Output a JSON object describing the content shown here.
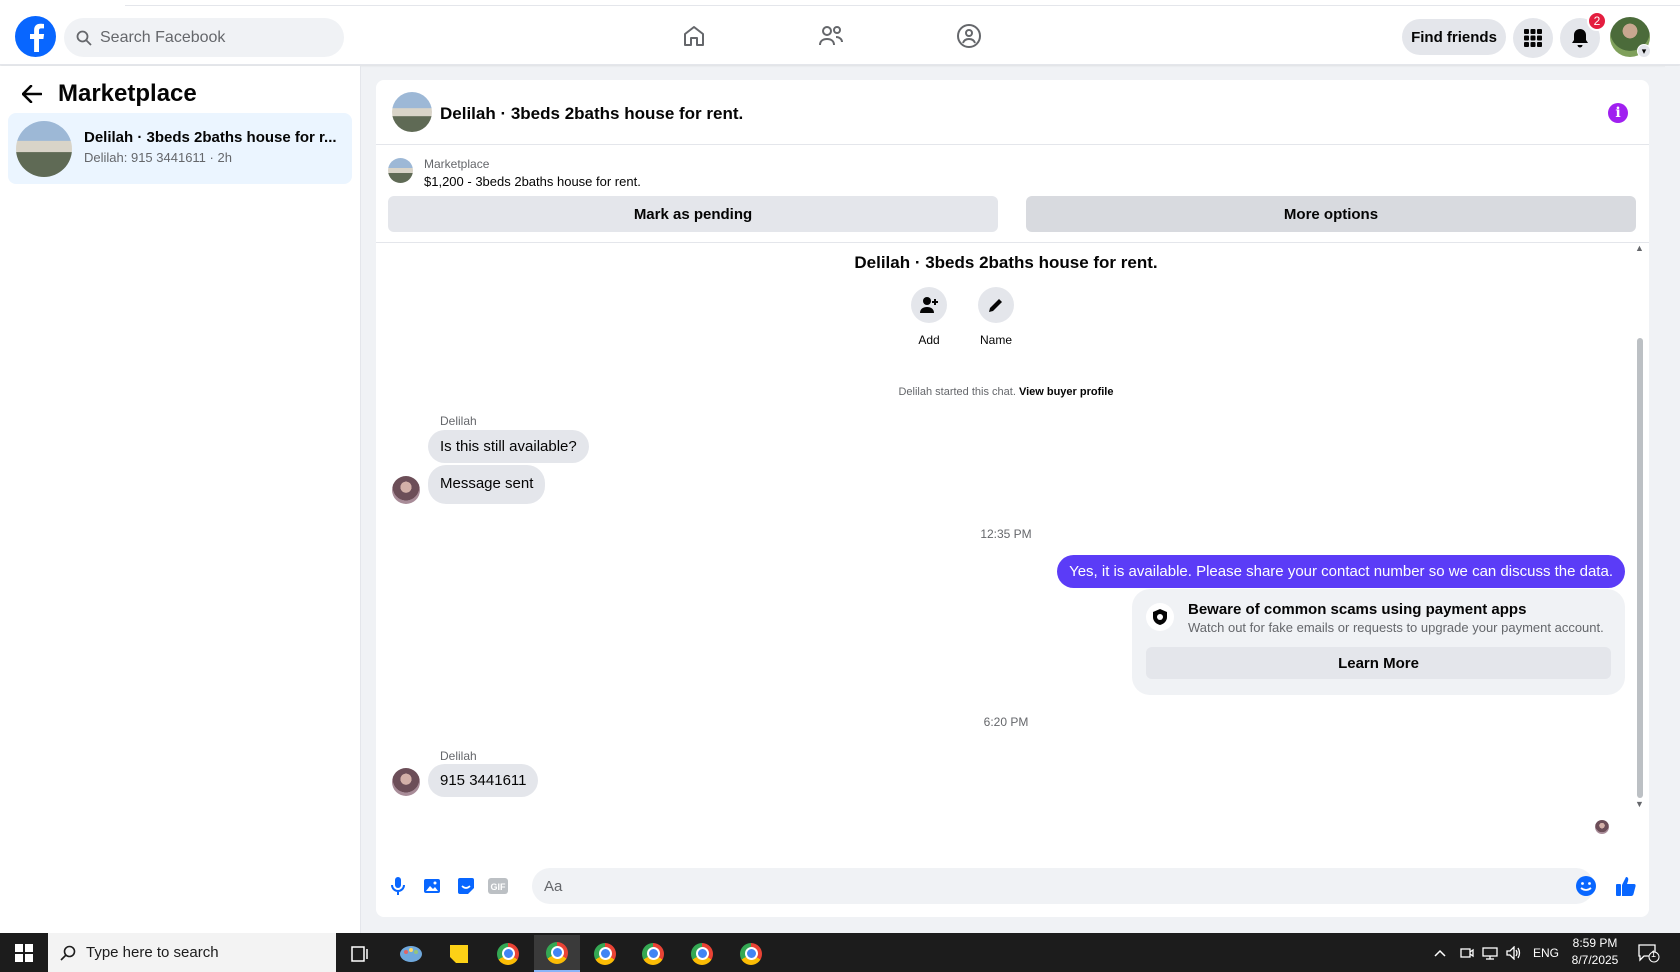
{
  "header": {
    "search_placeholder": "Search Facebook",
    "find_friends": "Find friends",
    "notification_count": "2"
  },
  "sidebar": {
    "title": "Marketplace",
    "conversations": [
      {
        "title": "Delilah · 3beds 2baths house for r...",
        "subtitle": "Delilah: 915 3441611 · 2h"
      }
    ]
  },
  "chat": {
    "title": "Delilah · 3beds 2baths house for rent.",
    "marketplace_label": "Marketplace",
    "listing": "$1,200 - 3beds 2baths house for rent.",
    "mark_pending": "Mark as pending",
    "more_options": "More options",
    "thread_title": "Delilah · 3beds 2baths house for rent.",
    "actions": {
      "add": "Add",
      "name": "Name"
    },
    "started_text": "Delilah started this chat.",
    "view_profile": "View buyer profile",
    "messages": {
      "sender": "Delilah",
      "m1": "Is this still available?",
      "m2": "Message sent",
      "time1": "12:35 PM",
      "out1": "Yes, it is available. Please share your contact number so we can discuss the data.",
      "scam_title": "Beware of common scams using payment apps",
      "scam_sub": "Watch out for fake emails or requests to upgrade your payment account.",
      "learn_more": "Learn More",
      "time2": "6:20 PM",
      "sender2": "Delilah",
      "m3": "915 3441611"
    },
    "composer_placeholder": "Aa"
  },
  "taskbar": {
    "search_placeholder": "Type here to search",
    "lang": "ENG",
    "time": "8:59 PM",
    "date": "8/7/2025",
    "notif_count": "1"
  },
  "colors": {
    "brand": "#0866ff",
    "outgoing_bubble": "#5b3cf7",
    "info": "#a020f0"
  }
}
